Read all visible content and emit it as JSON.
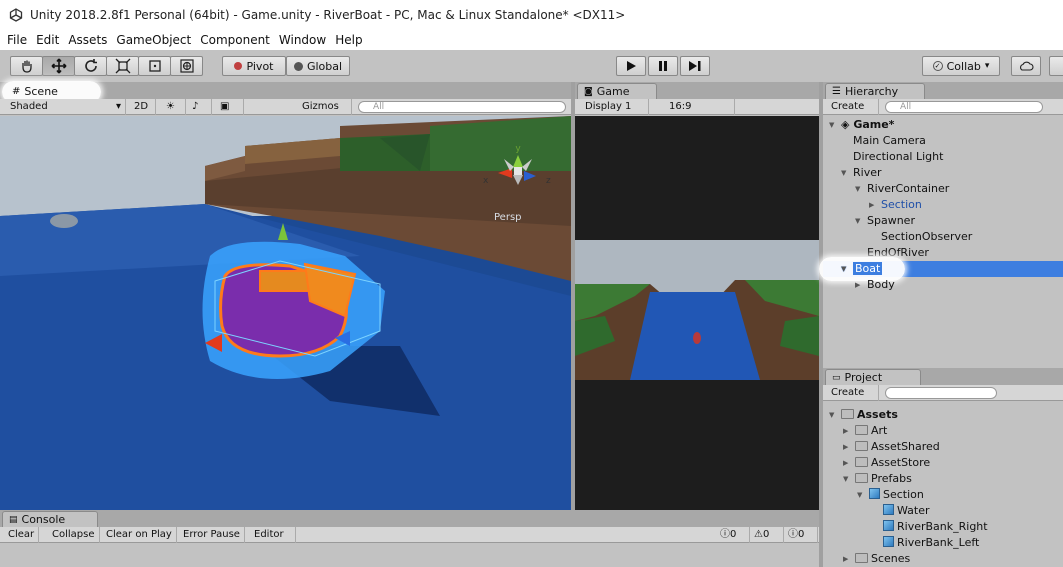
{
  "window": {
    "title": "Unity 2018.2.8f1 Personal (64bit) - Game.unity - RiverBoat - PC, Mac & Linux Standalone* <DX11>"
  },
  "menu": [
    "File",
    "Edit",
    "Assets",
    "GameObject",
    "Component",
    "Window",
    "Help"
  ],
  "toolbar": {
    "tools": [
      "hand-icon",
      "move-icon",
      "rotate-icon",
      "scale-icon",
      "rect-icon",
      "transform-icon"
    ],
    "pivot_label": "Pivot",
    "global_label": "Global",
    "collab_label": "Collab",
    "collab_arrow": "▾"
  },
  "scene": {
    "tab_label": "Scene",
    "shading_label": "Shaded",
    "mode_2d_label": "2D",
    "gizmos_label": "Gizmos",
    "search_placeholder": "All",
    "persp_label": "Persp",
    "gizmo_axes": {
      "x": "x",
      "y": "y",
      "z": "z"
    }
  },
  "game": {
    "tab_label": "Game",
    "display_label": "Display 1",
    "aspect_label": "16:9"
  },
  "hierarchy": {
    "tab_label": "Hierarchy",
    "create_label": "Create",
    "search_placeholder": "All",
    "scene_name": "Game*",
    "items": [
      {
        "label": "Main Camera",
        "depth": 0,
        "arrow": "none",
        "prefab": false
      },
      {
        "label": "Directional Light",
        "depth": 0,
        "arrow": "none",
        "prefab": false
      },
      {
        "label": "River",
        "depth": 0,
        "arrow": "down",
        "prefab": false
      },
      {
        "label": "RiverContainer",
        "depth": 1,
        "arrow": "down",
        "prefab": false
      },
      {
        "label": "Section",
        "depth": 2,
        "arrow": "right",
        "prefab": true
      },
      {
        "label": "Spawner",
        "depth": 1,
        "arrow": "down",
        "prefab": false
      },
      {
        "label": "SectionObserver",
        "depth": 2,
        "arrow": "none",
        "prefab": false
      },
      {
        "label": "EndOfRiver",
        "depth": 1,
        "arrow": "none",
        "prefab": false
      },
      {
        "label": "Boat",
        "depth": 0,
        "arrow": "down",
        "prefab": false,
        "selected": true
      },
      {
        "label": "Body",
        "depth": 1,
        "arrow": "right",
        "prefab": false
      }
    ]
  },
  "project": {
    "tab_label": "Project",
    "create_label": "Create",
    "items": [
      {
        "label": "Assets",
        "depth": 0,
        "arrow": "down",
        "kind": "folder",
        "bold": true
      },
      {
        "label": "Art",
        "depth": 1,
        "arrow": "right",
        "kind": "folder"
      },
      {
        "label": "AssetShared",
        "depth": 1,
        "arrow": "right",
        "kind": "folder"
      },
      {
        "label": "AssetStore",
        "depth": 1,
        "arrow": "right",
        "kind": "folder"
      },
      {
        "label": "Prefabs",
        "depth": 1,
        "arrow": "down",
        "kind": "folder"
      },
      {
        "label": "Section",
        "depth": 2,
        "arrow": "down",
        "kind": "prefab"
      },
      {
        "label": "Water",
        "depth": 3,
        "arrow": "none",
        "kind": "prefab"
      },
      {
        "label": "RiverBank_Right",
        "depth": 3,
        "arrow": "none",
        "kind": "prefab"
      },
      {
        "label": "RiverBank_Left",
        "depth": 3,
        "arrow": "none",
        "kind": "prefab"
      },
      {
        "label": "Scenes",
        "depth": 1,
        "arrow": "right",
        "kind": "folder"
      }
    ]
  },
  "console": {
    "tab_label": "Console",
    "clear_label": "Clear",
    "collapse_label": "Collapse",
    "clear_on_play_label": "Clear on Play",
    "error_pause_label": "Error Pause",
    "editor_label": "Editor",
    "info_count": "0",
    "warning_count": "0",
    "error_count": "0"
  },
  "colors": {
    "selection": "#3d7ee0",
    "prefab_text": "#1f4fa8",
    "water": "#1f4fa0",
    "sky": "#b9c4cf"
  }
}
